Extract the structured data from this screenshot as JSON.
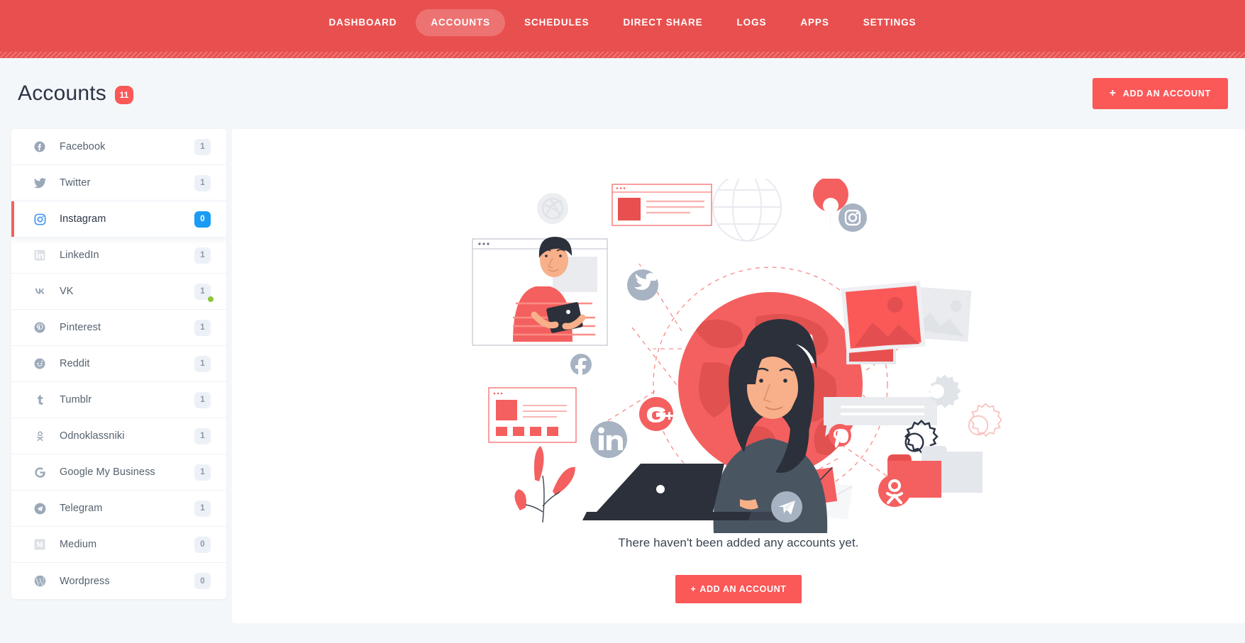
{
  "nav": {
    "items": [
      {
        "label": "DASHBOARD",
        "active": false
      },
      {
        "label": "ACCOUNTS",
        "active": true
      },
      {
        "label": "SCHEDULES",
        "active": false
      },
      {
        "label": "DIRECT SHARE",
        "active": false
      },
      {
        "label": "LOGS",
        "active": false
      },
      {
        "label": "APPS",
        "active": false
      },
      {
        "label": "SETTINGS",
        "active": false
      }
    ]
  },
  "header": {
    "title": "Accounts",
    "count_badge": "11",
    "add_button_label": "ADD AN ACCOUNT",
    "add_button_icon": "plus-icon"
  },
  "sidebar": {
    "items": [
      {
        "label": "Facebook",
        "count": "1",
        "icon": "facebook-icon",
        "active": false,
        "online": false
      },
      {
        "label": "Twitter",
        "count": "1",
        "icon": "twitter-icon",
        "active": false,
        "online": false
      },
      {
        "label": "Instagram",
        "count": "0",
        "icon": "instagram-icon",
        "active": true,
        "online": false
      },
      {
        "label": "LinkedIn",
        "count": "1",
        "icon": "linkedin-icon",
        "active": false,
        "online": false
      },
      {
        "label": "VK",
        "count": "1",
        "icon": "vk-icon",
        "active": false,
        "online": true
      },
      {
        "label": "Pinterest",
        "count": "1",
        "icon": "pinterest-icon",
        "active": false,
        "online": false
      },
      {
        "label": "Reddit",
        "count": "1",
        "icon": "reddit-icon",
        "active": false,
        "online": false
      },
      {
        "label": "Tumblr",
        "count": "1",
        "icon": "tumblr-icon",
        "active": false,
        "online": false
      },
      {
        "label": "Odnoklassniki",
        "count": "1",
        "icon": "odnoklassniki-icon",
        "active": false,
        "online": false
      },
      {
        "label": "Google My Business",
        "count": "1",
        "icon": "google-icon",
        "active": false,
        "online": false
      },
      {
        "label": "Telegram",
        "count": "1",
        "icon": "telegram-icon",
        "active": false,
        "online": false
      },
      {
        "label": "Medium",
        "count": "0",
        "icon": "medium-icon",
        "active": false,
        "online": false
      },
      {
        "label": "Wordpress",
        "count": "0",
        "icon": "wordpress-icon",
        "active": false,
        "online": false
      }
    ]
  },
  "main": {
    "empty_message": "There haven't been added any accounts yet.",
    "empty_button_label": "ADD AN ACCOUNT",
    "empty_button_icon": "plus-icon",
    "illustration": {
      "name": "social-media-world-illustration",
      "elements": [
        "globe",
        "woman-with-laptop",
        "man-in-browser-window",
        "location-pin",
        "twitter-badge",
        "facebook-badge",
        "linkedin-badge",
        "instagram-badge",
        "google-plus-badge",
        "pinterest-badge",
        "telegram-badge",
        "odnoklassniki-badge",
        "dribbble-badge",
        "wireframe-globe",
        "video-play-card",
        "image-cards",
        "chat-bubble",
        "gears",
        "folders",
        "envelopes",
        "plant"
      ]
    }
  },
  "colors": {
    "brand_red": "#e8504f",
    "button_red": "#fb5858",
    "active_blue": "#1a9bf5",
    "online_green": "#8cc63e",
    "page_bg": "#f4f7f9",
    "text_dark": "#2b3445"
  }
}
